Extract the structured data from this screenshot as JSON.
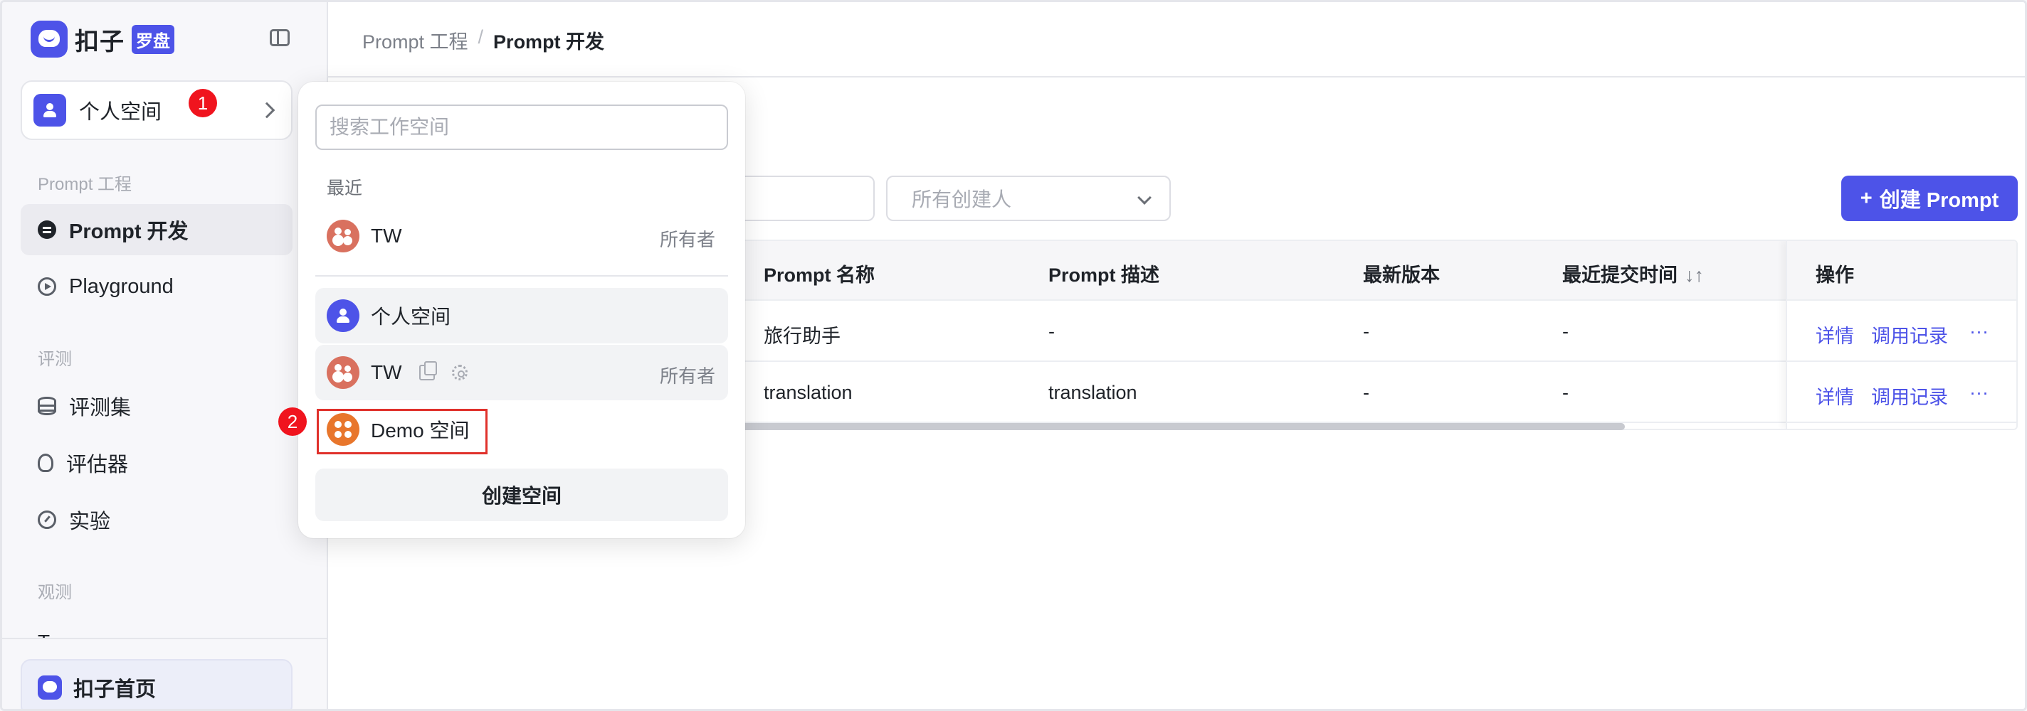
{
  "brand": {
    "name": "扣子",
    "badge": "罗盘",
    "accent": "#4d53e8"
  },
  "sidebar": {
    "current_space": "个人空间",
    "sections": [
      {
        "label": "Prompt 工程",
        "items": [
          {
            "label": "Prompt 开发",
            "icon": "chat-icon",
            "active": true
          },
          {
            "label": "Playground",
            "icon": "play-icon"
          }
        ]
      },
      {
        "label": "评测",
        "items": [
          {
            "label": "评测集",
            "icon": "database-icon"
          },
          {
            "label": "评估器",
            "icon": "bulb-icon"
          },
          {
            "label": "实验",
            "icon": "gauge-icon"
          }
        ]
      },
      {
        "label": "观测",
        "items": [
          {
            "label": "Trace",
            "icon": "trace-icon"
          }
        ]
      }
    ],
    "home_label": "扣子首页"
  },
  "annotations": {
    "step1": "1",
    "step2": "2",
    "highlight_color": "#e0312b"
  },
  "breadcrumb": {
    "parent": "Prompt 工程",
    "separator": "/",
    "current": "Prompt 开发"
  },
  "toolbar": {
    "creator_placeholder": "所有创建人",
    "create_label": "创建 Prompt",
    "create_icon": "+"
  },
  "table": {
    "columns": [
      "Prompt 名称",
      "Prompt 描述",
      "最新版本",
      "最近提交时间",
      "操作"
    ],
    "sort_icon": "↓↑",
    "rows": [
      {
        "name": "旅行助手",
        "desc": "-",
        "version": "-",
        "time": "-"
      },
      {
        "name": "translation",
        "desc": "translation",
        "version": "-",
        "time": "-"
      }
    ],
    "actions": {
      "detail": "详情",
      "log": "调用记录",
      "more": "···"
    }
  },
  "space_dropdown": {
    "search_placeholder": "搜索工作空间",
    "recent_label": "最近",
    "recent": [
      {
        "name": "TW",
        "role": "所有者"
      }
    ],
    "spaces": [
      {
        "name": "个人空间",
        "role": ""
      },
      {
        "name": "TW",
        "role": "所有者"
      },
      {
        "name": "Demo 空间",
        "role": ""
      }
    ],
    "create_label": "创建空间"
  }
}
